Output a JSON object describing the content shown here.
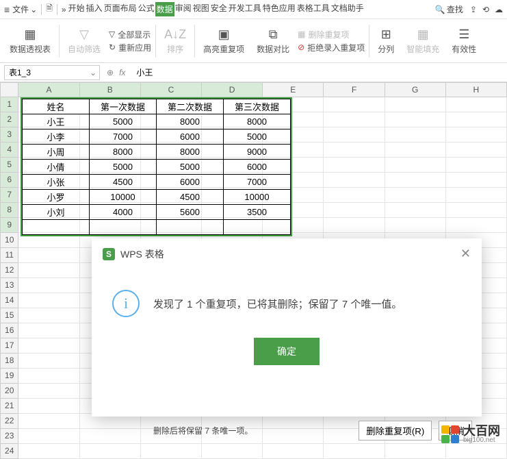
{
  "menubar": {
    "file_label": "文件",
    "tabs": [
      "开始",
      "插入",
      "页面布局",
      "公式",
      "数据",
      "审阅",
      "视图",
      "安全",
      "开发工具",
      "特色应用",
      "表格工具",
      "文档助手"
    ],
    "active_tab_index": 4,
    "search_label": "查找"
  },
  "ribbon": {
    "pivot": "数据透视表",
    "autofilter": "自动筛选",
    "show_all": "全部显示",
    "reapply": "重新应用",
    "sort": "排序",
    "highlight_dup": "高亮重复项",
    "data_compare": "数据对比",
    "remove_dup": "删除重复项",
    "reject_dup_entry": "拒绝录入重复项",
    "text_to_cols": "分列",
    "smart_fill": "智能填充",
    "data_validation": "有效性"
  },
  "formula_bar": {
    "name_box": "表1_3",
    "fx_label": "fx",
    "formula_value": "小王"
  },
  "columns": [
    "A",
    "B",
    "C",
    "D",
    "E",
    "F",
    "G",
    "H"
  ],
  "table": {
    "headers": [
      "姓名",
      "第一次数据",
      "第二次数据",
      "第三次数据"
    ],
    "rows": [
      [
        "小王",
        "5000",
        "8000",
        "8000"
      ],
      [
        "小李",
        "7000",
        "6000",
        "5000"
      ],
      [
        "小周",
        "8000",
        "8000",
        "9000"
      ],
      [
        "小倩",
        "5000",
        "5000",
        "6000"
      ],
      [
        "小张",
        "4500",
        "6000",
        "7000"
      ],
      [
        "小罗",
        "10000",
        "4500",
        "10000"
      ],
      [
        "小刘",
        "4000",
        "5600",
        "3500"
      ]
    ]
  },
  "dialog": {
    "title": "WPS 表格",
    "message": "发现了 1 个重复项，已将其删除；保留了 7 个唯一值。",
    "ok_label": "确定"
  },
  "bottom": {
    "hint": "删除后将保留 7 条唯一项。",
    "remove_btn": "删除重复项(R)",
    "cancel_btn": "取消"
  },
  "watermark": {
    "main": "大百网",
    "sub": "big100.net"
  },
  "chart_data": {
    "type": "table",
    "columns": [
      "姓名",
      "第一次数据",
      "第二次数据",
      "第三次数据"
    ],
    "rows": [
      [
        "小王",
        5000,
        8000,
        8000
      ],
      [
        "小李",
        7000,
        6000,
        5000
      ],
      [
        "小周",
        8000,
        8000,
        9000
      ],
      [
        "小倩",
        5000,
        5000,
        6000
      ],
      [
        "小张",
        4500,
        6000,
        7000
      ],
      [
        "小罗",
        10000,
        4500,
        10000
      ],
      [
        "小刘",
        4000,
        5600,
        3500
      ]
    ]
  }
}
